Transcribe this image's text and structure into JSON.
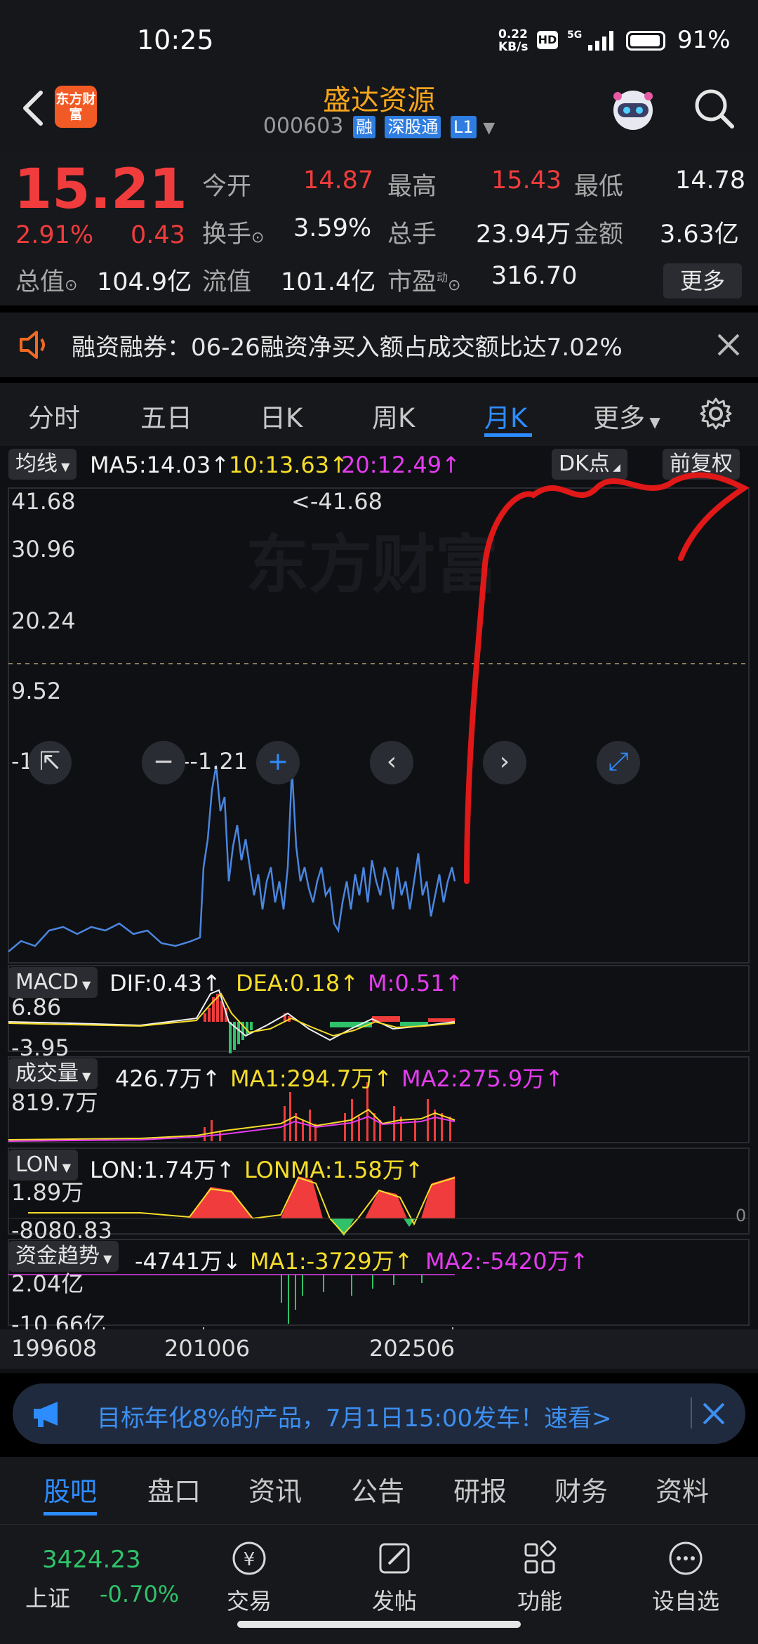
{
  "status": {
    "time": "10:25",
    "net_speed": "0.22",
    "net_unit": "KB/s",
    "hd": "HD",
    "signal": "5G",
    "battery": "91%"
  },
  "header": {
    "logo": "东方财富",
    "title": "盛达资源",
    "code": "000603",
    "tags": [
      "融",
      "深股通",
      "L1"
    ]
  },
  "quote": {
    "price": "15.21",
    "change_pct": "2.91%",
    "change": "0.43",
    "open_label": "今开",
    "open": "14.87",
    "high_label": "最高",
    "high": "15.43",
    "low_label": "最低",
    "low": "14.78",
    "turnover_label": "换手",
    "turnover": "3.59%",
    "volume_label": "总手",
    "volume": "23.94万",
    "amount_label": "金额",
    "amount": "3.63亿",
    "mktcap_label": "总值",
    "mktcap": "104.9亿",
    "float_label": "流值",
    "float": "101.4亿",
    "pe_label": "市盈",
    "pe_sup": "动",
    "pe": "316.70",
    "more": "更多"
  },
  "notice": {
    "text": "融资融券：06-26融资净买入额占成交额比达7.02%"
  },
  "ktabs": [
    "分时",
    "五日",
    "日K",
    "周K",
    "月K",
    "更多"
  ],
  "ktab_active": 4,
  "main_ind": {
    "selector": "均线",
    "ma5": "MA5:14.03",
    "ma10": "10:13.63",
    "ma20": "20:12.49",
    "dk": "DK点",
    "fq": "前复权",
    "y_ticks": [
      "41.68",
      "30.96",
      "20.24",
      "9.52",
      "-1.21"
    ],
    "max_label": "<-41.68",
    "min_label": "<--1.21"
  },
  "macd": {
    "selector": "MACD",
    "dif": "DIF:0.43",
    "dea": "DEA:0.18",
    "m": "M:0.51",
    "top": "6.86",
    "bottom": "-3.95"
  },
  "vol": {
    "selector": "成交量",
    "value": "426.7万",
    "ma1": "MA1:294.7万",
    "ma2": "MA2:275.9万",
    "top": "819.7万"
  },
  "lon": {
    "selector": "LON",
    "lon": "LON:1.74万",
    "lonma": "LONMA:1.58万",
    "top": "1.89万",
    "bottom": "-8080.83",
    "right": "0"
  },
  "fund": {
    "selector": "资金趋势",
    "value": "-4741万",
    "ma1": "MA1:-3729万",
    "ma2": "MA2:-5420万",
    "top": "2.04亿",
    "bottom": "-10.66亿"
  },
  "xaxis": [
    "199608",
    "201006",
    "202506"
  ],
  "ad": {
    "text": "目标年化8%的产品，7月1日15:00发车！速看>"
  },
  "btabs": [
    "股吧",
    "盘口",
    "资讯",
    "公告",
    "研报",
    "财务",
    "资料"
  ],
  "bnav": {
    "index_value": "3424.23",
    "index_name": "上证",
    "index_change": "-0.70%",
    "items": [
      "交易",
      "发帖",
      "功能",
      "设自选"
    ]
  }
}
